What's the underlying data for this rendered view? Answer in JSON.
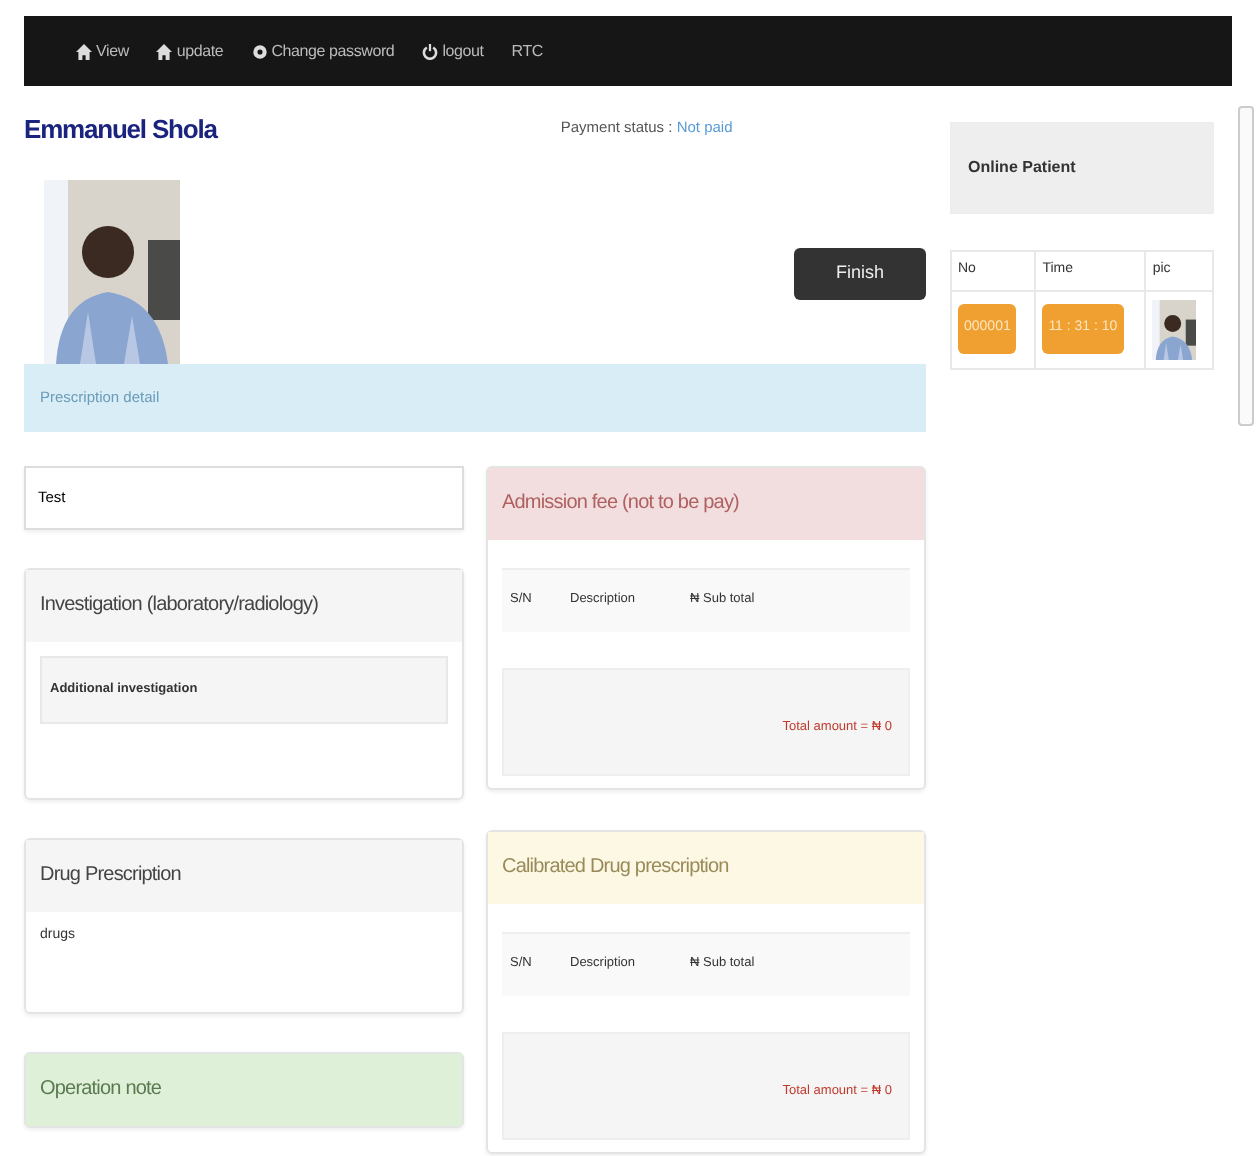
{
  "navbar": {
    "items": [
      {
        "kind": "home",
        "label": "View"
      },
      {
        "kind": "home",
        "label": "update"
      },
      {
        "kind": "settings",
        "label": "Change password"
      },
      {
        "kind": "power",
        "label": "logout"
      },
      {
        "kind": "plain",
        "label": "RTC"
      }
    ]
  },
  "patient": {
    "name": "Emmanuel Shola",
    "payment_label": "Payment status :",
    "payment_value": "Not paid"
  },
  "finish_button": "Finish",
  "prescription_banner": "Prescription detail",
  "test_field": {
    "value": "Test"
  },
  "left_panels": [
    {
      "kind": "default",
      "title": "Investigation (laboratory/radiology)",
      "inner_well": "Additional investigation"
    },
    {
      "kind": "default",
      "title": "Drug Prescription",
      "body": "drugs"
    },
    {
      "kind": "success",
      "title": "Operation note"
    }
  ],
  "right_panels": [
    {
      "kind": "danger",
      "title": "Admission fee (not to be pay)",
      "columns": [
        "S/N",
        "Description",
        "₦ Sub total"
      ],
      "total": "Total amount = ₦ 0"
    },
    {
      "kind": "warning",
      "title": "Calibrated Drug prescription",
      "columns": [
        "S/N",
        "Description",
        "₦ Sub total"
      ],
      "total": "Total amount = ₦ 0"
    }
  ],
  "online_patient": {
    "title": "Online Patient",
    "columns": [
      "No",
      "Time",
      "pic"
    ],
    "rows": [
      {
        "no": "000001",
        "time": "11 : 31 : 10"
      }
    ]
  }
}
